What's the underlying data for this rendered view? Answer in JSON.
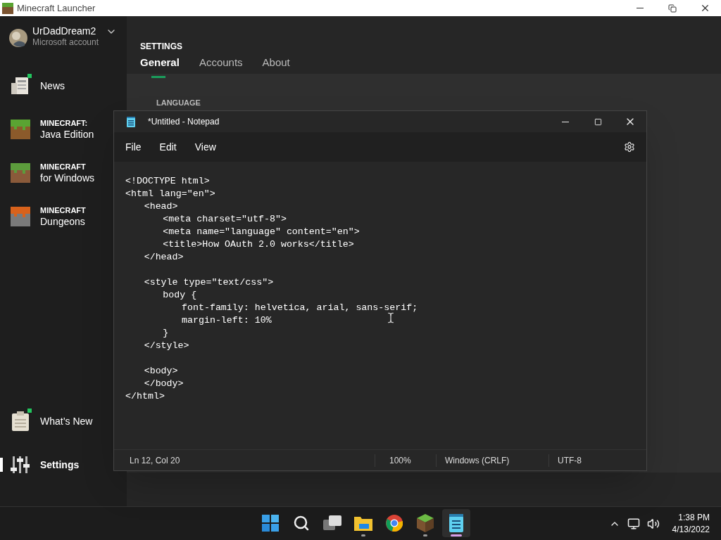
{
  "window": {
    "title": "Minecraft Launcher"
  },
  "account": {
    "name": "UrDadDream2",
    "type": "Microsoft account"
  },
  "sidebar": {
    "items": [
      {
        "kind": "news",
        "title": "News",
        "badge": true,
        "selected": false
      },
      {
        "kind": "java",
        "overline": "MINECRAFT:",
        "title": "Java Edition",
        "badge": false,
        "selected": false
      },
      {
        "kind": "windows",
        "overline": "MINECRAFT",
        "title": "for Windows",
        "badge": false,
        "selected": false
      },
      {
        "kind": "dungeons",
        "overline": "MINECRAFT",
        "title": "Dungeons",
        "badge": false,
        "selected": false
      },
      {
        "kind": "whatsnew",
        "title": "What’s New",
        "badge": true,
        "selected": false
      },
      {
        "kind": "settings",
        "title": "Settings",
        "badge": false,
        "selected": true
      }
    ]
  },
  "settings": {
    "heading": "SETTINGS",
    "tabs": [
      {
        "label": "General",
        "selected": true
      },
      {
        "label": "Accounts",
        "selected": false
      },
      {
        "label": "About",
        "selected": false
      }
    ],
    "section": "LANGUAGE"
  },
  "notepad": {
    "title": "*Untitled - Notepad",
    "menu": [
      "File",
      "Edit",
      "View"
    ],
    "lines": [
      {
        "text": "<!DOCTYPE html>"
      },
      {
        "text": "<html lang=\"en\">"
      },
      {
        "text": "\t<head>"
      },
      {
        "text": "\t\t<meta charset=\"utf-8\">"
      },
      {
        "text": "\t\t<meta name=\"language\" content=\"en\">"
      },
      {
        "text": "\t\t<title>How OAuth 2.0 works</title>"
      },
      {
        "text": "\t</head>"
      },
      {
        "text": "\t<style type=\"text/css\">",
        "blank_before": true
      },
      {
        "text": "\t\tbody {"
      },
      {
        "text": "\t\t\tfont-family: helvetica, arial, sans-serif;"
      },
      {
        "text": "\t\t\tmargin-left: 10%"
      },
      {
        "text": "\t\t}"
      },
      {
        "text": "\t</style>"
      },
      {
        "text": "\t<body>",
        "blank_before": true
      },
      {
        "text": "\t</body>"
      },
      {
        "text": "</html>"
      }
    ],
    "status": {
      "position": "Ln 12, Col 20",
      "zoom": "100%",
      "line_endings": "Windows (CRLF)",
      "encoding": "UTF-8"
    }
  },
  "taskbar": {
    "apps": [
      {
        "kind": "start",
        "running": false,
        "active": false
      },
      {
        "kind": "search",
        "running": false,
        "active": false
      },
      {
        "kind": "taskview",
        "running": false,
        "active": false
      },
      {
        "kind": "explorer",
        "running": true,
        "active": false
      },
      {
        "kind": "browser",
        "running": false,
        "active": false
      },
      {
        "kind": "game",
        "running": true,
        "active": false
      },
      {
        "kind": "notepad",
        "running": true,
        "active": true
      }
    ],
    "time": "1:38 PM",
    "date": "4/13/2022"
  }
}
